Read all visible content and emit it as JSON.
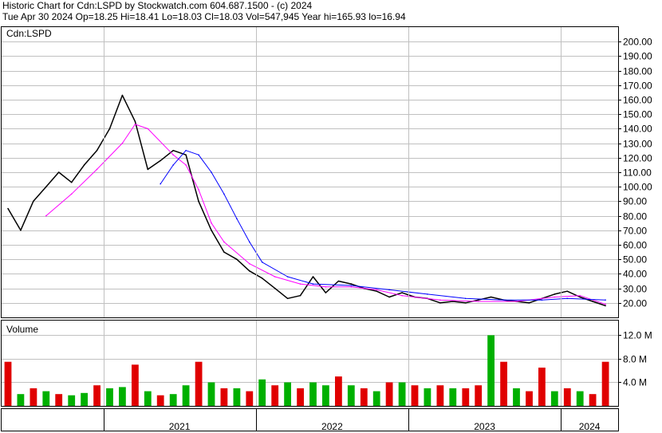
{
  "header": {
    "line1": "Historic Chart for Cdn:LSPD by Stockwatch.com 604.687.1500 - (c) 2024",
    "line2": "Tue Apr 30 2024   Op=18.25   Hi=18.41   Lo=18.03   Cl=18.03   Vol=547,945   Year hi=165.93   lo=16.94"
  },
  "price_panel": {
    "label": "Cdn:LSPD"
  },
  "volume_panel": {
    "label": "Volume"
  },
  "colors": {
    "price": "#000000",
    "ma_short": "#ff00ff",
    "ma_long": "#0000ff",
    "vol_up": "#00b000",
    "vol_down": "#e00000",
    "grid": "#c0c0c0"
  },
  "chart_data": [
    {
      "type": "line",
      "title": "",
      "ylim": [
        10,
        210
      ],
      "y_ticks": [
        "200.00",
        "190.00",
        "180.00",
        "170.00",
        "160.00",
        "150.00",
        "140.00",
        "130.00",
        "120.00",
        "110.00",
        "100.00",
        "90.00",
        "80.00",
        "70.00",
        "60.00",
        "50.00",
        "40.00",
        "30.00",
        "20.00"
      ],
      "x_ticks": [
        "2021",
        "2022",
        "2023",
        "2024"
      ],
      "series": [
        {
          "key": "close",
          "x": [
            "2020-05",
            "2020-06",
            "2020-07",
            "2020-08",
            "2020-09",
            "2020-10",
            "2020-11",
            "2020-12",
            "2021-01",
            "2021-02",
            "2021-03",
            "2021-04",
            "2021-05",
            "2021-06",
            "2021-07",
            "2021-08",
            "2021-09",
            "2021-10",
            "2021-11",
            "2021-12",
            "2022-01",
            "2022-02",
            "2022-03",
            "2022-04",
            "2022-05",
            "2022-06",
            "2022-07",
            "2022-08",
            "2022-09",
            "2022-10",
            "2022-11",
            "2022-12",
            "2023-01",
            "2023-02",
            "2023-03",
            "2023-04",
            "2023-05",
            "2023-06",
            "2023-07",
            "2023-08",
            "2023-09",
            "2023-10",
            "2023-11",
            "2023-12",
            "2024-01",
            "2024-02",
            "2024-03",
            "2024-04"
          ],
          "y": [
            85,
            70,
            90,
            100,
            110,
            103,
            115,
            125,
            140,
            163,
            145,
            112,
            118,
            125,
            122,
            90,
            70,
            55,
            50,
            42,
            37,
            30,
            23,
            25,
            38,
            27,
            35,
            33,
            30,
            28,
            24,
            27,
            24,
            23,
            20,
            21,
            20,
            22,
            24,
            22,
            21,
            20,
            23,
            26,
            28,
            24,
            21,
            18
          ]
        },
        {
          "key": "ma_short",
          "x": [
            "2020-08",
            "2020-10",
            "2020-12",
            "2021-02",
            "2021-03",
            "2021-04",
            "2021-06",
            "2021-07",
            "2021-08",
            "2021-09",
            "2021-10",
            "2021-12",
            "2022-02",
            "2022-04",
            "2022-06",
            "2022-08",
            "2022-10",
            "2022-12",
            "2023-03",
            "2023-06",
            "2023-09",
            "2023-12",
            "2024-02",
            "2024-04"
          ],
          "y": [
            80,
            95,
            112,
            130,
            143,
            140,
            122,
            115,
            98,
            75,
            62,
            47,
            38,
            33,
            31,
            31,
            29,
            25,
            22,
            21,
            21,
            24,
            25,
            19
          ]
        },
        {
          "key": "ma_long",
          "x": [
            "2021-05",
            "2021-06",
            "2021-07",
            "2021-08",
            "2021-09",
            "2021-10",
            "2021-11",
            "2021-12",
            "2022-01",
            "2022-03",
            "2022-05",
            "2022-08",
            "2022-11",
            "2023-02",
            "2023-05",
            "2023-08",
            "2023-11",
            "2024-01",
            "2024-04"
          ],
          "y": [
            102,
            115,
            125,
            122,
            110,
            95,
            78,
            62,
            48,
            38,
            33,
            32,
            29,
            26,
            23,
            22,
            22,
            23,
            22
          ]
        }
      ]
    },
    {
      "type": "bar",
      "title": "",
      "ylim": [
        0,
        14.5
      ],
      "y_ticks": [
        "12.0 M",
        "8.0 M",
        "4.0 M"
      ],
      "unit": "M",
      "x": [
        "2020-05",
        "2020-06",
        "2020-07",
        "2020-08",
        "2020-09",
        "2020-10",
        "2020-11",
        "2020-12",
        "2021-01",
        "2021-02",
        "2021-03",
        "2021-04",
        "2021-05",
        "2021-06",
        "2021-07",
        "2021-08",
        "2021-09",
        "2021-10",
        "2021-11",
        "2021-12",
        "2022-01",
        "2022-02",
        "2022-03",
        "2022-04",
        "2022-05",
        "2022-06",
        "2022-07",
        "2022-08",
        "2022-09",
        "2022-10",
        "2022-11",
        "2022-12",
        "2023-01",
        "2023-02",
        "2023-03",
        "2023-04",
        "2023-05",
        "2023-06",
        "2023-07",
        "2023-08",
        "2023-09",
        "2023-10",
        "2023-11",
        "2023-12",
        "2024-01",
        "2024-02",
        "2024-03",
        "2024-04"
      ],
      "values": [
        7.5,
        2.0,
        3.0,
        2.5,
        2.0,
        1.8,
        2.2,
        3.5,
        3.0,
        3.2,
        7.0,
        2.5,
        1.8,
        2.0,
        3.5,
        7.5,
        4.0,
        3.0,
        3.0,
        2.5,
        4.5,
        3.5,
        4.0,
        3.0,
        4.0,
        3.5,
        5.0,
        3.5,
        3.0,
        2.5,
        4.0,
        4.0,
        3.5,
        3.0,
        3.5,
        3.0,
        3.0,
        3.5,
        12.0,
        7.5,
        3.0,
        2.5,
        6.5,
        2.5,
        3.0,
        2.5,
        2.0,
        7.5
      ],
      "up": [
        false,
        true,
        false,
        true,
        false,
        true,
        true,
        false,
        true,
        true,
        false,
        true,
        false,
        true,
        true,
        false,
        true,
        false,
        true,
        false,
        true,
        false,
        true,
        false,
        true,
        true,
        false,
        true,
        false,
        true,
        false,
        true,
        false,
        true,
        false,
        true,
        false,
        false,
        true,
        false,
        true,
        false,
        false,
        true,
        false,
        true,
        false,
        false
      ]
    }
  ]
}
